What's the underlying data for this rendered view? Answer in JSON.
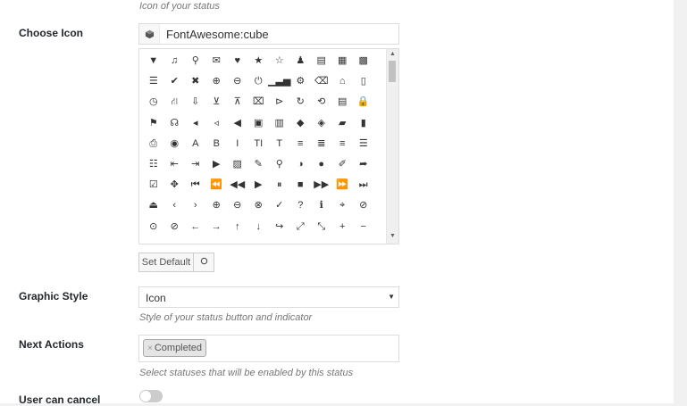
{
  "icon_section": {
    "top_description": "Icon of your status",
    "label": "Choose Icon",
    "prefix_icon": "cube-icon",
    "value": "FontAwesome:cube"
  },
  "icon_grid": [
    {
      "name": "filter-icon",
      "glyph": "▼"
    },
    {
      "name": "music-icon",
      "glyph": "♫"
    },
    {
      "name": "search-icon",
      "glyph": "⚲"
    },
    {
      "name": "envelope-icon",
      "glyph": "✉"
    },
    {
      "name": "heart-icon",
      "glyph": "♥"
    },
    {
      "name": "star-icon",
      "glyph": "★"
    },
    {
      "name": "star-outline-icon",
      "glyph": "☆"
    },
    {
      "name": "user-icon",
      "glyph": "♟"
    },
    {
      "name": "film-icon",
      "glyph": "▤"
    },
    {
      "name": "th-large-icon",
      "glyph": "▦"
    },
    {
      "name": "th-icon",
      "glyph": "▩"
    },
    {
      "name": "th-list-icon",
      "glyph": "☰"
    },
    {
      "name": "check-icon",
      "glyph": "✔"
    },
    {
      "name": "times-icon",
      "glyph": "✖"
    },
    {
      "name": "search-plus-icon",
      "glyph": "⊕"
    },
    {
      "name": "search-minus-icon",
      "glyph": "⊖"
    },
    {
      "name": "power-off-icon",
      "glyph": "⏻"
    },
    {
      "name": "signal-icon",
      "glyph": "▁▃▅"
    },
    {
      "name": "cog-icon",
      "glyph": "⚙"
    },
    {
      "name": "trash-icon",
      "glyph": "⌫"
    },
    {
      "name": "home-icon",
      "glyph": "⌂"
    },
    {
      "name": "file-icon",
      "glyph": "▯"
    },
    {
      "name": "clock-icon",
      "glyph": "◷"
    },
    {
      "name": "road-icon",
      "glyph": "⛙"
    },
    {
      "name": "download-icon",
      "glyph": "⇩"
    },
    {
      "name": "arrow-circle-down-icon",
      "glyph": "⊻"
    },
    {
      "name": "arrow-circle-up-icon",
      "glyph": "⊼"
    },
    {
      "name": "inbox-icon",
      "glyph": "⌧"
    },
    {
      "name": "play-circle-icon",
      "glyph": "⊳"
    },
    {
      "name": "repeat-icon",
      "glyph": "↻"
    },
    {
      "name": "refresh-icon",
      "glyph": "⟲"
    },
    {
      "name": "list-alt-icon",
      "glyph": "▤"
    },
    {
      "name": "lock-icon",
      "glyph": "🔒"
    },
    {
      "name": "flag-icon",
      "glyph": "⚑"
    },
    {
      "name": "headphones-icon",
      "glyph": "☊"
    },
    {
      "name": "volume-off-icon",
      "glyph": "◂"
    },
    {
      "name": "volume-down-icon",
      "glyph": "◃"
    },
    {
      "name": "volume-up-icon",
      "glyph": "◀"
    },
    {
      "name": "qrcode-icon",
      "glyph": "▣"
    },
    {
      "name": "barcode-icon",
      "glyph": "▥"
    },
    {
      "name": "tag-icon",
      "glyph": "◆"
    },
    {
      "name": "tags-icon",
      "glyph": "◈"
    },
    {
      "name": "book-icon",
      "glyph": "▰"
    },
    {
      "name": "bookmark-icon",
      "glyph": "▮"
    },
    {
      "name": "print-icon",
      "glyph": "⎙"
    },
    {
      "name": "camera-icon",
      "glyph": "◉"
    },
    {
      "name": "font-icon",
      "glyph": "A"
    },
    {
      "name": "bold-icon",
      "glyph": "B"
    },
    {
      "name": "italic-icon",
      "glyph": "I"
    },
    {
      "name": "text-height-icon",
      "glyph": "TI"
    },
    {
      "name": "text-width-icon",
      "glyph": "T"
    },
    {
      "name": "align-left-icon",
      "glyph": "≡"
    },
    {
      "name": "align-center-icon",
      "glyph": "≣"
    },
    {
      "name": "align-right-icon",
      "glyph": "≡"
    },
    {
      "name": "align-justify-icon",
      "glyph": "☰"
    },
    {
      "name": "list-icon",
      "glyph": "☷"
    },
    {
      "name": "outdent-icon",
      "glyph": "⇤"
    },
    {
      "name": "indent-icon",
      "glyph": "⇥"
    },
    {
      "name": "video-icon",
      "glyph": "▶"
    },
    {
      "name": "picture-icon",
      "glyph": "▨"
    },
    {
      "name": "pencil-icon",
      "glyph": "✎"
    },
    {
      "name": "map-marker-icon",
      "glyph": "⚲"
    },
    {
      "name": "adjust-icon",
      "glyph": "◑"
    },
    {
      "name": "tint-icon",
      "glyph": "●"
    },
    {
      "name": "edit-icon",
      "glyph": "✐"
    },
    {
      "name": "share-icon",
      "glyph": "➦"
    },
    {
      "name": "check-square-icon",
      "glyph": "☑"
    },
    {
      "name": "arrows-icon",
      "glyph": "✥"
    },
    {
      "name": "step-backward-icon",
      "glyph": "⏮"
    },
    {
      "name": "fast-backward-icon",
      "glyph": "⏪"
    },
    {
      "name": "backward-icon",
      "glyph": "◀◀"
    },
    {
      "name": "play-icon",
      "glyph": "▶"
    },
    {
      "name": "pause-icon",
      "glyph": "⏸"
    },
    {
      "name": "stop-icon",
      "glyph": "■"
    },
    {
      "name": "forward-icon",
      "glyph": "▶▶"
    },
    {
      "name": "fast-forward-icon",
      "glyph": "⏩"
    },
    {
      "name": "step-forward-icon",
      "glyph": "⏭"
    },
    {
      "name": "eject-icon",
      "glyph": "⏏"
    },
    {
      "name": "chevron-left-icon",
      "glyph": "‹"
    },
    {
      "name": "chevron-right-icon",
      "glyph": "›"
    },
    {
      "name": "plus-circle-icon",
      "glyph": "⊕"
    },
    {
      "name": "minus-circle-icon",
      "glyph": "⊖"
    },
    {
      "name": "times-circle-icon",
      "glyph": "⊗"
    },
    {
      "name": "check-circle-icon",
      "glyph": "✓"
    },
    {
      "name": "question-circle-icon",
      "glyph": "?"
    },
    {
      "name": "info-circle-icon",
      "glyph": "ℹ"
    },
    {
      "name": "crosshairs-icon",
      "glyph": "⌖"
    },
    {
      "name": "times-circle-outline-icon",
      "glyph": "⊘"
    },
    {
      "name": "check-circle-outline-icon",
      "glyph": "⊙"
    },
    {
      "name": "ban-icon",
      "glyph": "⊘"
    },
    {
      "name": "arrow-left-icon",
      "glyph": "←"
    },
    {
      "name": "arrow-right-icon",
      "glyph": "→"
    },
    {
      "name": "arrow-up-icon",
      "glyph": "↑"
    },
    {
      "name": "arrow-down-icon",
      "glyph": "↓"
    },
    {
      "name": "mail-forward-icon",
      "glyph": "↪"
    },
    {
      "name": "expand-icon",
      "glyph": "⤢"
    },
    {
      "name": "compress-icon",
      "glyph": "⤡"
    },
    {
      "name": "plus-icon",
      "glyph": "+"
    },
    {
      "name": "minus-icon",
      "glyph": "−"
    }
  ],
  "actions": {
    "set_default_label": "Set Default",
    "clear_icon": "circle-icon"
  },
  "graphic_style": {
    "label": "Graphic Style",
    "selected": "Icon",
    "description": "Style of your status button and indicator"
  },
  "next_actions": {
    "label": "Next Actions",
    "tags": [
      "Completed"
    ],
    "description": "Select statuses that will be enabled by this status"
  },
  "user_can_cancel": {
    "label": "User can cancel",
    "enabled": false
  },
  "colors": {
    "toggle_off": "#cccccc",
    "panel_bg": "#ffffff",
    "page_bg": "#f1f1f1"
  }
}
